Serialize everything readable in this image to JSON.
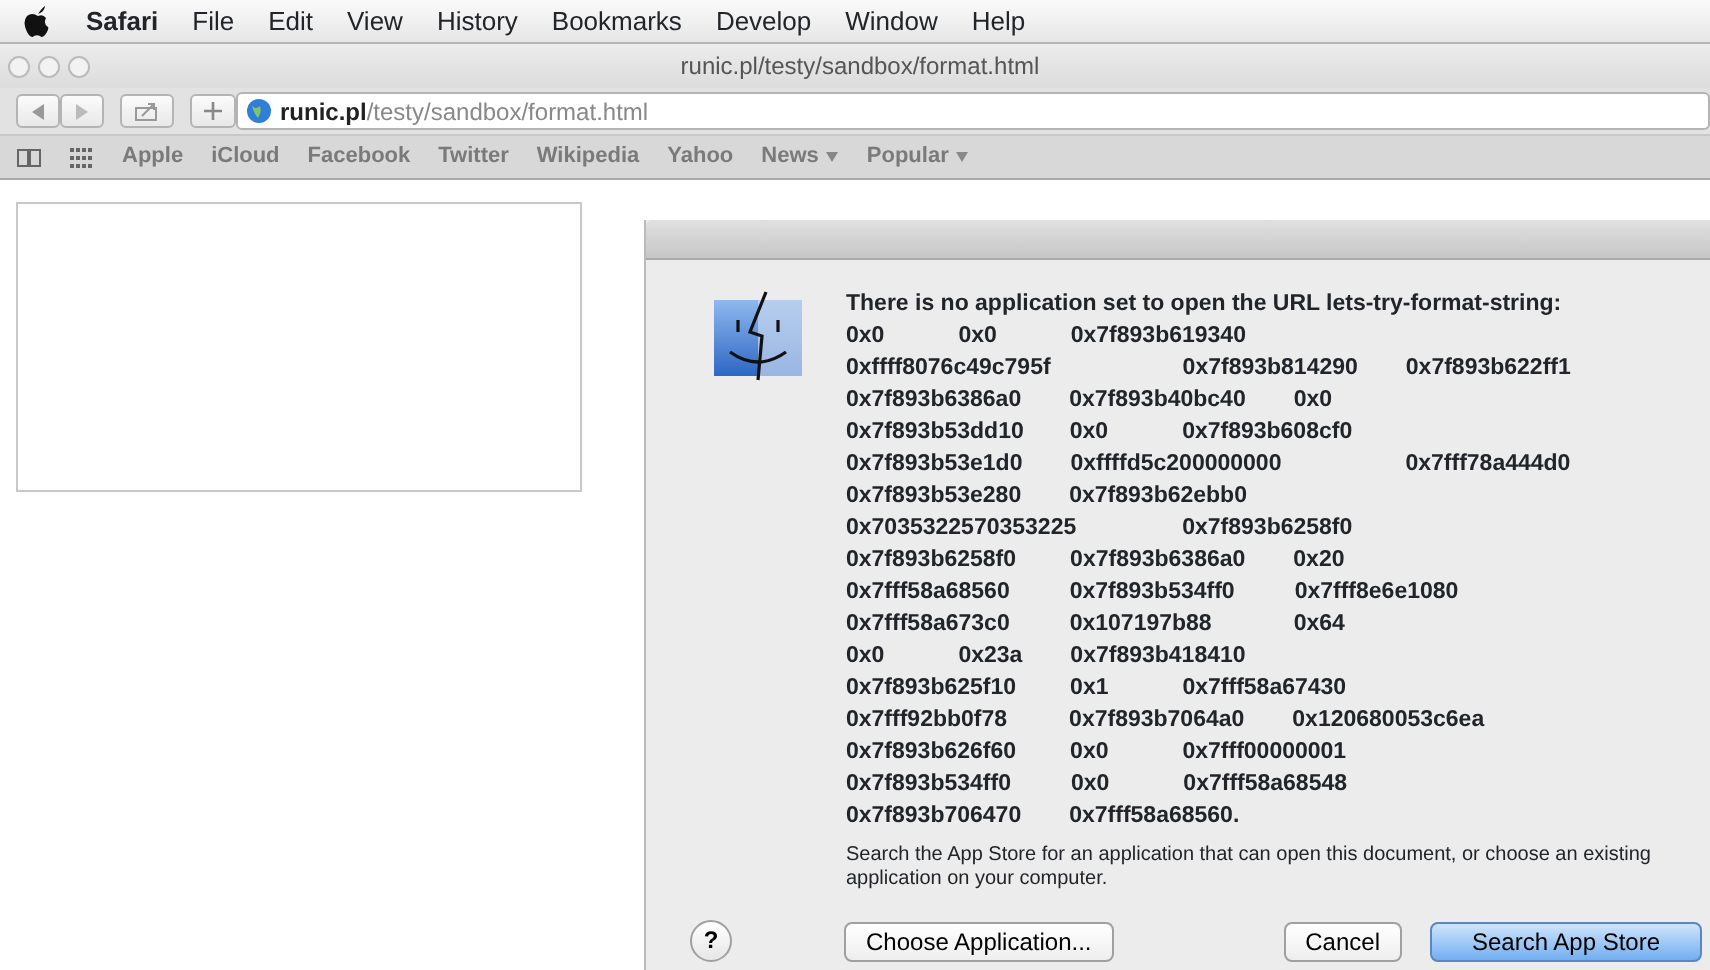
{
  "menu_bar": {
    "app": "Safari",
    "items": [
      "File",
      "Edit",
      "View",
      "History",
      "Bookmarks",
      "Develop",
      "Window",
      "Help"
    ]
  },
  "window": {
    "title": "runic.pl/testy/sandbox/format.html"
  },
  "address_bar": {
    "domain": "runic.pl",
    "path": "/testy/sandbox/format.html"
  },
  "bookmarks": [
    {
      "label": "Apple",
      "menu": false
    },
    {
      "label": "iCloud",
      "menu": false
    },
    {
      "label": "Facebook",
      "menu": false
    },
    {
      "label": "Twitter",
      "menu": false
    },
    {
      "label": "Wikipedia",
      "menu": false
    },
    {
      "label": "Yahoo",
      "menu": false
    },
    {
      "label": "News",
      "menu": true
    },
    {
      "label": "Popular",
      "menu": true
    }
  ],
  "dialog": {
    "heading": "There is no application set to open the URL lets-try-format-string:",
    "lines": [
      [
        "0x0",
        "0x0",
        "0x7f893b619340"
      ],
      [
        "0xffff8076c49c795f",
        "0x7f893b814290",
        "0x7f893b622ff1"
      ],
      [
        "0x7f893b6386a0",
        "0x7f893b40bc40",
        "0x0"
      ],
      [
        "0x7f893b53dd10",
        "0x0",
        "0x7f893b608cf0"
      ],
      [
        "0x7f893b53e1d0",
        "0xffffd5c200000000",
        "0x7fff78a444d0"
      ],
      [
        "0x7f893b53e280",
        "0x7f893b62ebb0"
      ],
      [
        "0x7035322570353225",
        "0x7f893b6258f0"
      ],
      [
        "0x7f893b6258f0",
        "0x7f893b6386a0",
        "0x20"
      ],
      [
        "0x7fff58a68560",
        "0x7f893b534ff0",
        "0x7fff8e6e1080"
      ],
      [
        "0x7fff58a673c0",
        "0x107197b88",
        "0x64"
      ],
      [
        "0x0",
        "0x23a",
        "0x7f893b418410"
      ],
      [
        "0x7f893b625f10",
        "0x1",
        "0x7fff58a67430"
      ],
      [
        "0x7fff92bb0f78",
        "0x7f893b7064a0",
        "0x120680053c6ea"
      ],
      [
        "0x7f893b626f60",
        "0x0",
        "0x7fff00000001"
      ],
      [
        "0x7f893b534ff0",
        "0x0",
        "0x7fff58a68548"
      ],
      [
        "0x7f893b706470",
        "0x7fff58a68560."
      ]
    ],
    "info": "Search the App Store for an application that can open this document, or choose an existing application on your computer.",
    "help": "?",
    "buttons": [
      {
        "label": "Choose Application...",
        "default": false
      },
      {
        "label": "Cancel",
        "default": false
      },
      {
        "label": "Search App Store",
        "default": true
      }
    ]
  }
}
